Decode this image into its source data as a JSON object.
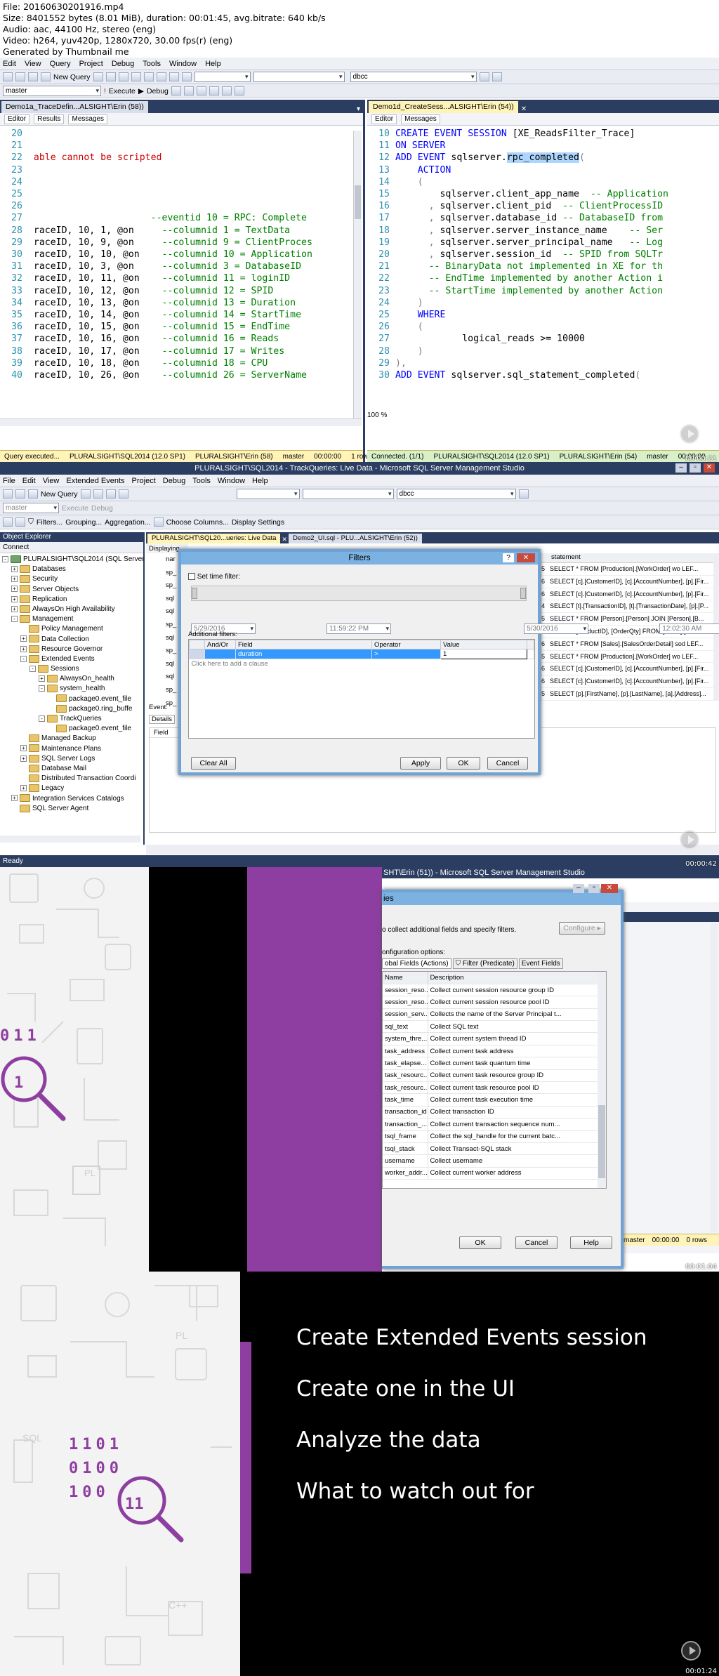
{
  "header": {
    "lines": [
      "File: 20160630201916.mp4",
      "Size: 8401552 bytes (8.01 MiB), duration: 00:01:45, avg.bitrate: 640 kb/s",
      "Audio: aac, 44100 Hz, stereo (eng)",
      "Video: h264, yuv420p, 1280x720, 30.00 fps(r) (eng)",
      "Generated by Thumbnail me"
    ]
  },
  "frame1": {
    "menu": [
      "Edit",
      "View",
      "Query",
      "Project",
      "Debug",
      "Tools",
      "Window",
      "Help"
    ],
    "toolbar": {
      "new_query": "New Query",
      "execute": "Execute",
      "debug": "Debug",
      "db_left": "master",
      "db_right": "dbcc"
    },
    "left_tab": "Demo1a_TraceDefin...ALSIGHT\\Erin (58))",
    "right_tab": "Demo1d_CreateSess...ALSIGHT\\Erin (54))",
    "left_subtabs": [
      "Editor",
      "Results",
      "Messages"
    ],
    "right_subtabs": [
      "Editor",
      "Messages"
    ],
    "left_code": [
      {
        "n": "20",
        "t": ""
      },
      {
        "n": "21",
        "t": ""
      },
      {
        "n": "22",
        "t": "able cannot be scripted"
      },
      {
        "n": "23",
        "t": ""
      },
      {
        "n": "24",
        "t": ""
      },
      {
        "n": "25",
        "t": ""
      },
      {
        "n": "26",
        "t": ""
      },
      {
        "n": "27",
        "t": "                     --eventid 10 = RPC: Complete"
      },
      {
        "n": "28",
        "t": "raceID, 10, 1, @on     --columnid 1 = TextData"
      },
      {
        "n": "29",
        "t": "raceID, 10, 9, @on     --columnid 9 = ClientProces"
      },
      {
        "n": "30",
        "t": "raceID, 10, 10, @on    --columnid 10 = Application"
      },
      {
        "n": "31",
        "t": "raceID, 10, 3, @on     --columnid 3 = DatabaseID"
      },
      {
        "n": "32",
        "t": "raceID, 10, 11, @on    --columnid 11 = loginID"
      },
      {
        "n": "33",
        "t": "raceID, 10, 12, @on    --columnid 12 = SPID"
      },
      {
        "n": "34",
        "t": "raceID, 10, 13, @on    --columnid 13 = Duration"
      },
      {
        "n": "35",
        "t": "raceID, 10, 14, @on    --columnid 14 = StartTime"
      },
      {
        "n": "36",
        "t": "raceID, 10, 15, @on    --columnid 15 = EndTime"
      },
      {
        "n": "37",
        "t": "raceID, 10, 16, @on    --columnid 16 = Reads"
      },
      {
        "n": "38",
        "t": "raceID, 10, 17, @on    --columnid 17 = Writes"
      },
      {
        "n": "39",
        "t": "raceID, 10, 18, @on    --columnid 18 = CPU"
      },
      {
        "n": "40",
        "t": "raceID, 10, 26, @on    --columnid 26 = ServerName"
      }
    ],
    "right_code": [
      {
        "n": "10",
        "t": "CREATE EVENT SESSION [XE_ReadsFilter_Trace]"
      },
      {
        "n": "11",
        "t": "ON SERVER"
      },
      {
        "n": "12",
        "t": "ADD EVENT sqlserver.rpc_completed("
      },
      {
        "n": "13",
        "t": "    ACTION"
      },
      {
        "n": "14",
        "t": "    ("
      },
      {
        "n": "15",
        "t": "        sqlserver.client_app_name  -- Application"
      },
      {
        "n": "16",
        "t": "      , sqlserver.client_pid  -- ClientProcessID"
      },
      {
        "n": "17",
        "t": "      , sqlserver.database_id -- DatabaseID from"
      },
      {
        "n": "18",
        "t": "      , sqlserver.server_instance_name    -- Ser"
      },
      {
        "n": "19",
        "t": "      , sqlserver.server_principal_name   -- Log"
      },
      {
        "n": "20",
        "t": "      , sqlserver.session_id  -- SPID from SQLTr"
      },
      {
        "n": "21",
        "t": "      -- BinaryData not implemented in XE for th"
      },
      {
        "n": "22",
        "t": "      -- EndTime implemented by another Action i"
      },
      {
        "n": "23",
        "t": "      -- StartTime implemented by another Action"
      },
      {
        "n": "24",
        "t": "    )"
      },
      {
        "n": "25",
        "t": "    WHERE"
      },
      {
        "n": "26",
        "t": "    ("
      },
      {
        "n": "27",
        "t": "            logical_reads >= 10000"
      },
      {
        "n": "28",
        "t": "    )"
      },
      {
        "n": "29",
        "t": "),"
      },
      {
        "n": "30",
        "t": "ADD EVENT sqlserver.sql_statement_completed("
      }
    ],
    "zoom": "100 %",
    "left_status": [
      "Query executed...",
      "PLURALSIGHT\\SQL2014 (12.0 SP1)",
      "PLURALSIGHT\\Erin (58)",
      "master",
      "00:00:00",
      "1 rows"
    ],
    "right_status": [
      "Connected. (1/1)",
      "PLURALSIGHT\\SQL2014 (12.0 SP1)",
      "PLURALSIGHT\\Erin (54)",
      "master",
      "00:00:00"
    ],
    "timestamp": "00:00:21"
  },
  "frame2": {
    "title": "PLURALSIGHT\\SQL2014 - TrackQueries: Live Data - Microsoft SQL Server Management Studio",
    "menu": [
      "File",
      "Edit",
      "View",
      "Extended Events",
      "Project",
      "Debug",
      "Tools",
      "Window",
      "Help"
    ],
    "toolbar": {
      "new_query": "New Query",
      "execute": "Execute",
      "debug": "Debug",
      "db": "dbcc",
      "db_left": "master"
    },
    "toolbar2": [
      "Filters...",
      "Grouping...",
      "Aggregation...",
      "Choose Columns...",
      "Display Settings"
    ],
    "oe_title": "Object Explorer",
    "oe_connect": "Connect",
    "tree": [
      {
        "l": 0,
        "e": "-",
        "t": "PLURALSIGHT\\SQL2014 (SQL Server 12"
      },
      {
        "l": 1,
        "e": "+",
        "t": "Databases"
      },
      {
        "l": 1,
        "e": "+",
        "t": "Security"
      },
      {
        "l": 1,
        "e": "+",
        "t": "Server Objects"
      },
      {
        "l": 1,
        "e": "+",
        "t": "Replication"
      },
      {
        "l": 1,
        "e": "+",
        "t": "AlwaysOn High Availability"
      },
      {
        "l": 1,
        "e": "-",
        "t": "Management"
      },
      {
        "l": 2,
        "e": "",
        "t": "Policy Management"
      },
      {
        "l": 2,
        "e": "+",
        "t": "Data Collection"
      },
      {
        "l": 2,
        "e": "+",
        "t": "Resource Governor"
      },
      {
        "l": 2,
        "e": "-",
        "t": "Extended Events"
      },
      {
        "l": 3,
        "e": "-",
        "t": "Sessions"
      },
      {
        "l": 4,
        "e": "+",
        "t": "AlwaysOn_health"
      },
      {
        "l": 4,
        "e": "-",
        "t": "system_health"
      },
      {
        "l": 5,
        "e": "",
        "t": "package0.event_file"
      },
      {
        "l": 5,
        "e": "",
        "t": "package0.ring_buffe"
      },
      {
        "l": 4,
        "e": "-",
        "t": "TrackQueries"
      },
      {
        "l": 5,
        "e": "",
        "t": "package0.event_file"
      },
      {
        "l": 2,
        "e": "",
        "t": "Managed Backup"
      },
      {
        "l": 2,
        "e": "+",
        "t": "Maintenance Plans"
      },
      {
        "l": 2,
        "e": "+",
        "t": "SQL Server Logs"
      },
      {
        "l": 2,
        "e": "",
        "t": "Database Mail"
      },
      {
        "l": 2,
        "e": "",
        "t": "Distributed Transaction Coordi"
      },
      {
        "l": 2,
        "e": "+",
        "t": "Legacy"
      },
      {
        "l": 1,
        "e": "+",
        "t": "Integration Services Catalogs"
      },
      {
        "l": 1,
        "e": "",
        "t": "SQL Server Agent"
      }
    ],
    "tabs": [
      "PLURALSIGHT\\SQL20...ueries: Live Data",
      "Demo2_UI.sql - PLU...ALSIGHT\\Erin (52))"
    ],
    "displaying": "Displaying",
    "left_col": [
      "nar",
      "sp_",
      "sp_",
      "sql",
      "sql",
      "sp_",
      "sql",
      "sp_",
      "sql",
      "sql",
      "sp_",
      "sp_"
    ],
    "statements_header": "statement",
    "statements": [
      {
        "n": "5",
        "t": "SELECT * FROM [Production].[WorkOrder] wo LEF..."
      },
      {
        "n": "6",
        "t": "SELECT [c].[CustomerID], [c].[AccountNumber], [p].[Fir..."
      },
      {
        "n": "6",
        "t": "SELECT [c].[CustomerID], [c].[AccountNumber], [p].[Fir..."
      },
      {
        "n": "4",
        "t": "SELECT [t].[TransactionID], [t].[TransactionDate], [p].[P..."
      },
      {
        "n": "5",
        "t": "SELECT * FROM [Person].[Person] JOIN [Person].[B..."
      },
      {
        "n": "5",
        "t": "SELECT [ProductID], [OrderQty] FROM [Sales].[Sales..."
      },
      {
        "n": "6",
        "t": "SELECT * FROM [Sales].[SalesOrderDetail] sod LEF..."
      },
      {
        "n": "5",
        "t": "SELECT * FROM [Production].[WorkOrder] wo LEF..."
      },
      {
        "n": "6",
        "t": "SELECT [c].[CustomerID], [c].[AccountNumber], [p].[Fir..."
      },
      {
        "n": "6",
        "t": "SELECT [c].[CustomerID], [c].[AccountNumber], [p].[Fir..."
      },
      {
        "n": "5",
        "t": "SELECT [p].[FirstName], [p].[LastName], [a].[Address]..."
      }
    ],
    "event_label": "Event:",
    "details_tab": "Details",
    "field_header": "Field",
    "dialog": {
      "title": "Filters",
      "help": "?",
      "close": "✕",
      "set_time": "Set time filter:",
      "date_from": "5/29/2016",
      "time_from": "11:59:22 PM",
      "date_to": "5/30/2016",
      "time_to": "12:02:30 AM",
      "additional": "Additional filters:",
      "cols": [
        "And/Or",
        "Field",
        "Operator",
        "Value"
      ],
      "row": {
        "field": "duration",
        "operator": ">",
        "value": "1"
      },
      "add_clause": "Click here to add a clause",
      "clear_all": "Clear All",
      "apply": "Apply",
      "ok": "OK",
      "cancel": "Cancel"
    },
    "status": "Ready",
    "timestamp": "00:00:42"
  },
  "frame3": {
    "title": "SHT\\Erin (51)) - Microsoft SQL Server Management Studio",
    "dlg_title": "ies",
    "desc": "o collect additional fields and specify filters.",
    "configure": "Configure",
    "options_label": "onfiguration options:",
    "tabs": [
      "obal Fields (Actions)",
      "Filter (Predicate)",
      "Event Fields"
    ],
    "col_name": "Name",
    "col_desc": "Description",
    "rows": [
      {
        "n": "session_reso...",
        "d": "Collect current session resource group ID"
      },
      {
        "n": "session_reso...",
        "d": "Collect current session resource pool ID"
      },
      {
        "n": "session_serv...",
        "d": "Collects the name of the Server Principal t..."
      },
      {
        "n": "sql_text",
        "d": "Collect SQL text"
      },
      {
        "n": "system_thre...",
        "d": "Collect current system thread ID"
      },
      {
        "n": "task_address",
        "d": "Collect current task address"
      },
      {
        "n": "task_elapse...",
        "d": "Collect current task quantum time"
      },
      {
        "n": "task_resourc...",
        "d": "Collect current task resource group ID"
      },
      {
        "n": "task_resourc...",
        "d": "Collect current task resource pool ID"
      },
      {
        "n": "task_time",
        "d": "Collect current task execution time"
      },
      {
        "n": "transaction_id",
        "d": "Collect transaction ID"
      },
      {
        "n": "transaction_...",
        "d": "Collect current transaction sequence num..."
      },
      {
        "n": "tsql_frame",
        "d": "Collect the sql_handle for the current batc..."
      },
      {
        "n": "tsql_stack",
        "d": "Collect Transact-SQL stack"
      },
      {
        "n": "username",
        "d": "Collect username"
      },
      {
        "n": "worker_addr...",
        "d": "Collect current worker address"
      }
    ],
    "ok": "OK",
    "cancel": "Cancel",
    "help": "Help",
    "status": [
      "master",
      "00:00:00",
      "0 rows"
    ],
    "deco_digits": [
      "0",
      "1",
      "1"
    ],
    "timestamp": "00:01:04"
  },
  "frame4": {
    "bullets": [
      "Create Extended Events session",
      "Create one in the UI",
      "Analyze the data",
      "What to watch out for"
    ],
    "deco_digits": [
      "1",
      "1",
      "0",
      "1",
      "0",
      "1",
      "0",
      "0",
      "1",
      "0",
      "0",
      "1",
      "1"
    ],
    "pattern_labels": [
      "SQL",
      "PL",
      "C++"
    ],
    "timestamp": "00:01:24"
  },
  "colors": {
    "purple": "#8e3ea0",
    "ssms_navy": "#2b3d61",
    "query_yellow": "#fff3b8"
  }
}
